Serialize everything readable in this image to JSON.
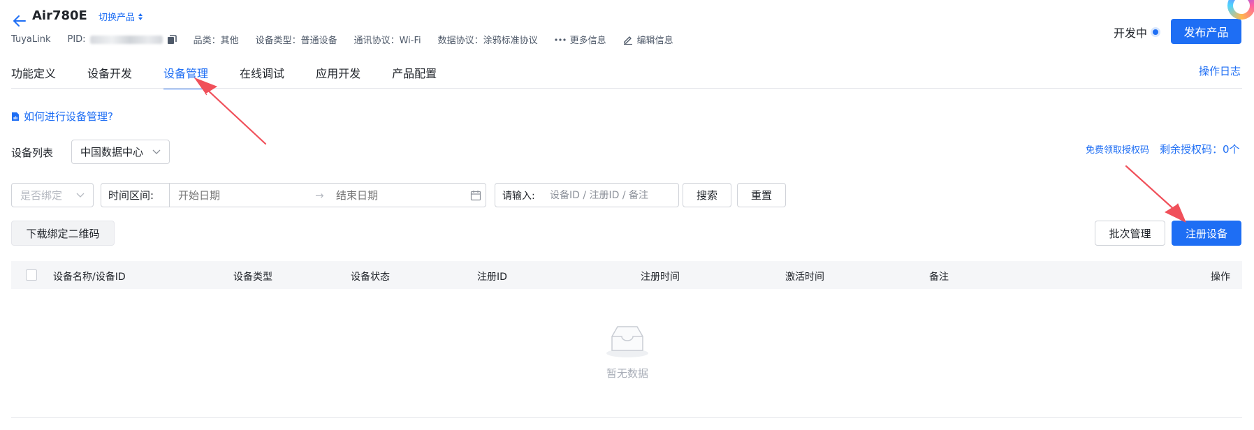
{
  "header": {
    "product_name": "Air780E",
    "switch_product": "切换产品",
    "protocol_type": "TuyaLink",
    "pid_label": "PID:",
    "category": "品类：其他",
    "device_type": "设备类型：普通设备",
    "comm_protocol": "通讯协议：Wi-Fi",
    "data_protocol": "数据协议：涂鸦标准协议",
    "more_info": "更多信息",
    "edit_info": "编辑信息",
    "status": "开发中",
    "publish_label": "发布产品"
  },
  "tabs": [
    {
      "label": "功能定义",
      "active": false
    },
    {
      "label": "设备开发",
      "active": false
    },
    {
      "label": "设备管理",
      "active": true
    },
    {
      "label": "在线调试",
      "active": false
    },
    {
      "label": "应用开发",
      "active": false
    },
    {
      "label": "产品配置",
      "active": false
    }
  ],
  "op_log": "操作日志",
  "help_link": "如何进行设备管理?",
  "device_list": {
    "label": "设备列表",
    "data_center": "中国数据中心",
    "free_code_link": "免费领取授权码",
    "remaining_codes": "剩余授权码：0个"
  },
  "filters": {
    "bind_placeholder": "是否绑定",
    "time_label": "时间区间:",
    "start_placeholder": "开始日期",
    "arrow": "→",
    "end_placeholder": "结束日期",
    "search_label": "请输入:",
    "search_placeholder": "设备ID / 注册ID / 备注",
    "search_btn": "搜索",
    "reset_btn": "重置"
  },
  "actions": {
    "download_qr": "下载绑定二维码",
    "batch_manage": "批次管理",
    "register_device": "注册设备"
  },
  "table": {
    "columns": [
      "设备名称/设备ID",
      "设备类型",
      "设备状态",
      "注册ID",
      "注册时间",
      "激活时间",
      "备注",
      "操作"
    ],
    "empty_text": "暂无数据"
  },
  "colors": {
    "accent": "#1e6ef4",
    "annotation_arrow": "#f0505a"
  }
}
